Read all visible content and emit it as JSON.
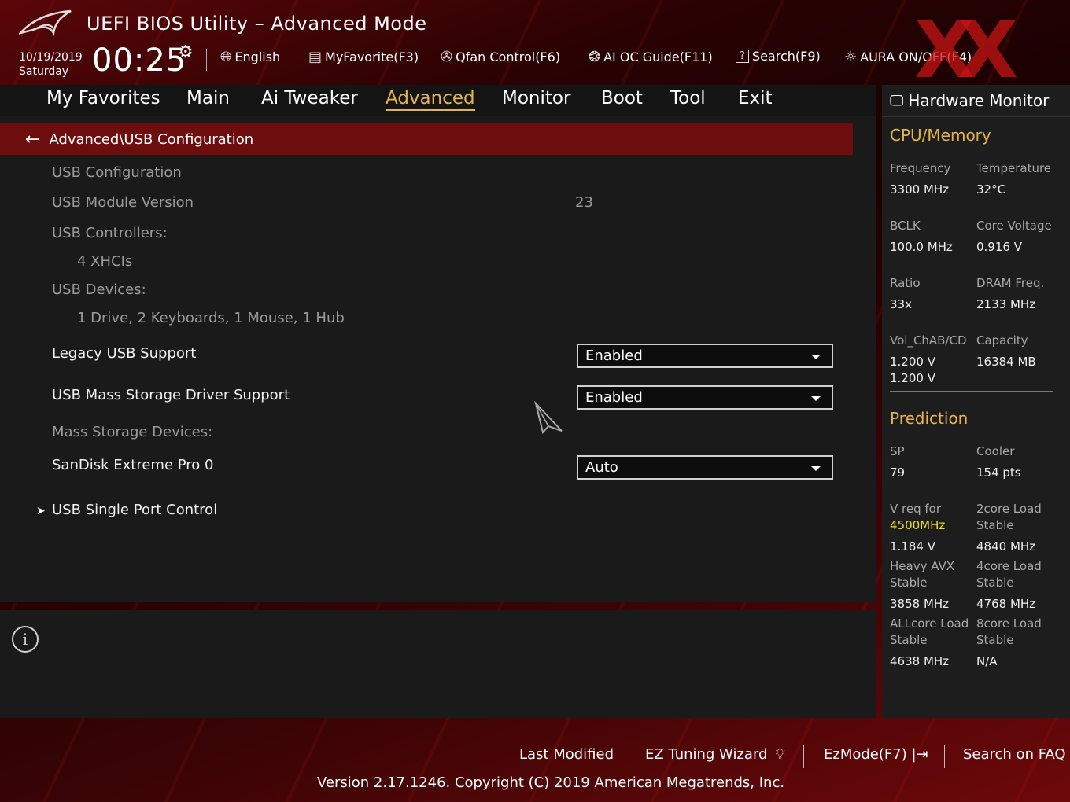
{
  "header": {
    "title": "UEFI BIOS Utility – Advanced Mode",
    "date": "10/19/2019",
    "day": "Saturday",
    "time": "00:25",
    "items": [
      {
        "label": "English",
        "icon": "globe-icon"
      },
      {
        "label": "MyFavorite(F3)",
        "icon": "favorite-list-icon"
      },
      {
        "label": "Qfan Control(F6)",
        "icon": "fan-icon"
      },
      {
        "label": "AI OC Guide(F11)",
        "icon": "ai-chip-icon"
      },
      {
        "label": "Search(F9)",
        "icon": "search-help-icon"
      },
      {
        "label": "AURA ON/OFF(F4)",
        "icon": "aura-light-icon"
      }
    ]
  },
  "tabs": [
    {
      "label": "My Favorites",
      "active": false
    },
    {
      "label": "Main",
      "active": false
    },
    {
      "label": "Ai Tweaker",
      "active": false
    },
    {
      "label": "Advanced",
      "active": true
    },
    {
      "label": "Monitor",
      "active": false
    },
    {
      "label": "Boot",
      "active": false
    },
    {
      "label": "Tool",
      "active": false
    },
    {
      "label": "Exit",
      "active": false
    }
  ],
  "breadcrumb": "Advanced\\USB Configuration",
  "settings": {
    "usb_config": "USB Configuration",
    "usb_module_version_label": "USB Module Version",
    "usb_module_version_value": "23",
    "usb_controllers_label": "USB Controllers:",
    "usb_controllers_value": "4 XHCIs",
    "usb_devices_label": "USB Devices:",
    "usb_devices_value": "1 Drive, 2 Keyboards, 1 Mouse, 1 Hub",
    "legacy_usb_label": "Legacy USB Support",
    "legacy_usb_value": "Enabled",
    "mass_storage_driver_label": "USB Mass Storage Driver Support",
    "mass_storage_driver_value": "Enabled",
    "mass_storage_devices_label": "Mass Storage Devices:",
    "sandisk_label": "SanDisk Extreme Pro 0",
    "sandisk_value": "Auto",
    "single_port_label": "USB Single Port Control"
  },
  "hardware_monitor": {
    "title": "Hardware Monitor",
    "cpu_memory": {
      "heading": "CPU/Memory",
      "frequency_label": "Frequency",
      "frequency_value": "3300 MHz",
      "temperature_label": "Temperature",
      "temperature_value": "32°C",
      "bclk_label": "BCLK",
      "bclk_value": "100.0 MHz",
      "core_voltage_label": "Core Voltage",
      "core_voltage_value": "0.916 V",
      "ratio_label": "Ratio",
      "ratio_value": "33x",
      "dram_freq_label": "DRAM Freq.",
      "dram_freq_value": "2133 MHz",
      "vol_label": "Vol_ChAB/CD",
      "vol_value_1": "1.200 V",
      "vol_value_2": "1.200 V",
      "capacity_label": "Capacity",
      "capacity_value": "16384 MB"
    },
    "prediction": {
      "heading": "Prediction",
      "sp_label": "SP",
      "sp_value": "79",
      "cooler_label": "Cooler",
      "cooler_value": "154 pts",
      "vreq_label": "V req for",
      "vreq_freq": "4500MHz",
      "vreq_value": "1.184 V",
      "core2_label_1": "2core Load",
      "core2_label_2": "Stable",
      "core2_value": "4840 MHz",
      "avx_label_1": "Heavy AVX",
      "avx_label_2": "Stable",
      "avx_value": "3858 MHz",
      "core4_label_1": "4core Load",
      "core4_label_2": "Stable",
      "core4_value": "4768 MHz",
      "allcore_label_1": "ALLcore Load",
      "allcore_label_2": "Stable",
      "allcore_value": "4638 MHz",
      "core8_label_1": "8core Load",
      "core8_label_2": "Stable",
      "core8_value": "N/A"
    }
  },
  "footer": {
    "last_modified": "Last Modified",
    "ez_tuning": "EZ Tuning Wizard",
    "ezmode": "EzMode(F7)",
    "search_faq": "Search on FAQ",
    "version": "Version 2.17.1246. Copyright (C) 2019 American Megatrends, Inc."
  },
  "colors": {
    "accent": "#e4b54d",
    "breadcrumb_bg": "#6e0d0d",
    "highlight_yellow": "#f0e020"
  }
}
